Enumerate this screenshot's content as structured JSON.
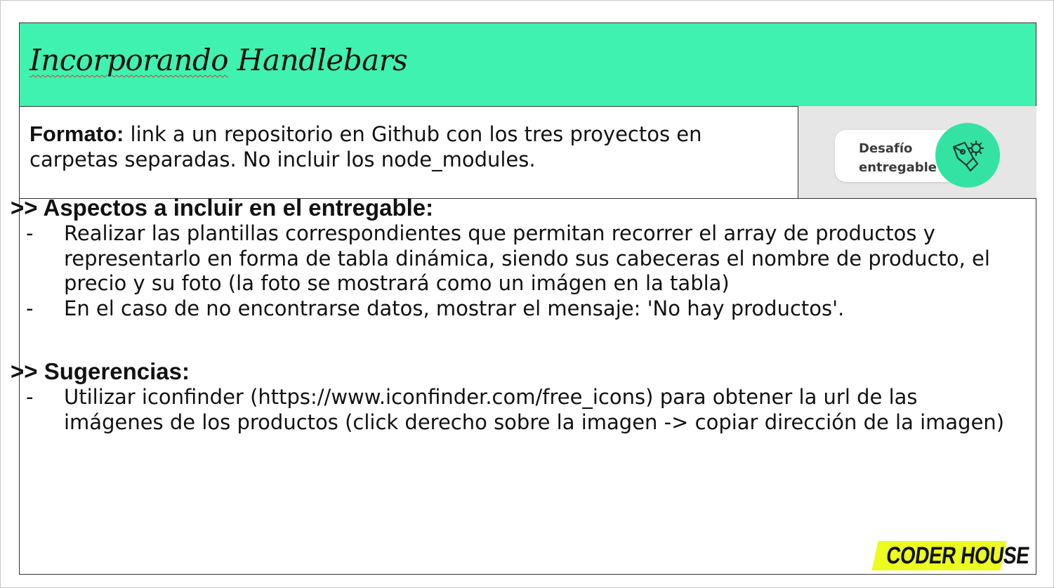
{
  "header": {
    "title_part1": "Incorporando",
    "title_part2": " Handlebars"
  },
  "format": {
    "label": "Formato:",
    "text": " link a un repositorio en Github con los tres proyectos en carpetas separadas. No incluir los node_modules."
  },
  "badge": {
    "line1": "Desafío",
    "line2": "entregable",
    "icon": "pen-gear-icon"
  },
  "sections": [
    {
      "heading": ">> Aspectos a incluir en el entregable:",
      "items": [
        {
          "bullet": "-",
          "text": "Realizar las plantillas correspondientes que permitan recorrer el array de productos y representarlo en forma de tabla dinámica, siendo sus cabeceras el nombre de producto, el precio y su foto (la foto se mostrará como un imágen en la tabla)"
        },
        {
          "bullet": "-",
          "text": "En el caso de no encontrarse datos, mostrar el mensaje: 'No hay productos'."
        }
      ]
    },
    {
      "heading": ">> Sugerencias:",
      "items": [
        {
          "bullet": "-",
          "text": "Utilizar iconfinder (https://www.iconfinder.com/free_icons) para obtener la url de las imágenes de los productos (click derecho sobre la imagen -> copiar dirección de la imagen)"
        }
      ]
    }
  ],
  "logo": {
    "text": "CODER HOUSE"
  },
  "colors": {
    "header_bg": "#3ff2b0",
    "badge_circle": "#34e3a4",
    "logo_bg": "#ecfc1f",
    "badge_cell_bg": "#e6e6e6"
  }
}
